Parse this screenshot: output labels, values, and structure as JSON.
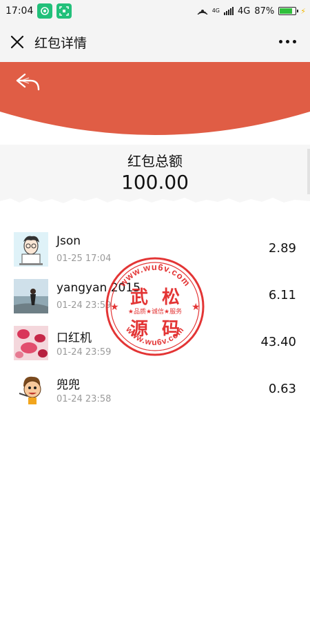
{
  "status_bar": {
    "time": "17:04",
    "network": "4G",
    "network_small": "4G",
    "battery": "87%"
  },
  "nav": {
    "title": "红包详情"
  },
  "summary": {
    "title": "红包总额",
    "amount": "100.00"
  },
  "records": [
    {
      "name": "Json",
      "time": "01-25 17:04",
      "amount": "2.89"
    },
    {
      "name": "yangyan 2015",
      "time": "01-24 23:59",
      "amount": "6.11"
    },
    {
      "name": "口红机",
      "time": "01-24 23:59",
      "amount": "43.40"
    },
    {
      "name": "兜兜",
      "time": "01-24 23:58",
      "amount": "0.63"
    }
  ],
  "watermark": {
    "top": "www.wu6v.com",
    "main1": "武",
    "main2": "松",
    "main3": "源",
    "main4": "码",
    "slogan": "★品质★诚信★服务",
    "bottom": "www.wu6v.com"
  },
  "colors": {
    "header_red": "#E05D45",
    "stamp_red": "#E02020",
    "app_green": "#22C07A"
  }
}
